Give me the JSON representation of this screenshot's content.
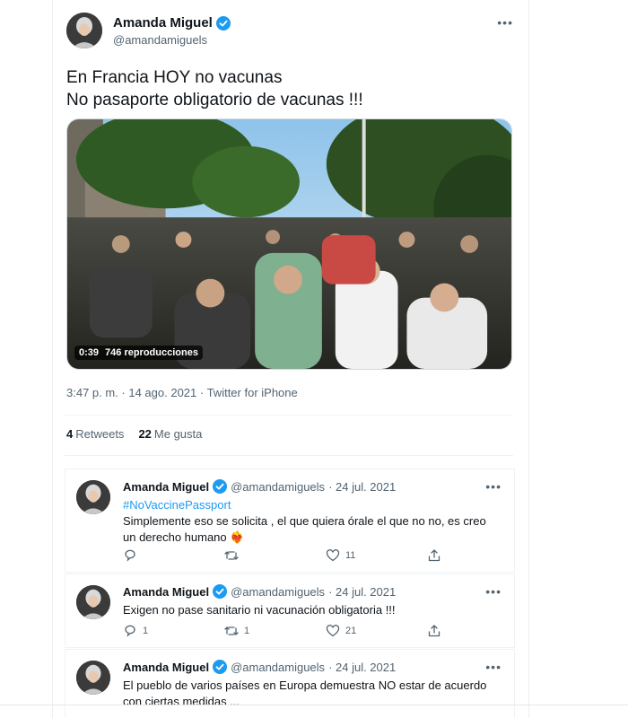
{
  "colors": {
    "accent": "#1d9bf0",
    "text": "#0f1419",
    "muted": "#536471",
    "border": "#eff3f4"
  },
  "main_tweet": {
    "author_name": "Amanda Miguel",
    "author_handle": "@amandamiguels",
    "text_lines": [
      "En Francia HOY no vacunas",
      "No pasaporte obligatorio de vacunas !!!"
    ],
    "media": {
      "duration": "0:39",
      "views": "746 reproducciones"
    },
    "meta": "3:47 p. m. · 14 ago. 2021 · Twitter for iPhone",
    "retweets": {
      "count": "4",
      "label": "Retweets"
    },
    "likes": {
      "count": "22",
      "label": "Me gusta"
    }
  },
  "replies": [
    {
      "name": "Amanda Miguel",
      "handle": "@amandamiguels",
      "date": "· 24 jul. 2021",
      "hashtag": "#NoVaccinePassport",
      "text": "Simplemente eso se solicita , el que quiera órale el que no no, es creo un derecho humano ❤️‍🔥",
      "counts": {
        "reply": "",
        "retweet": "",
        "like": "11"
      },
      "icons": [
        "reply-icon",
        "retweet-icon",
        "heart-icon",
        "share-icon"
      ]
    },
    {
      "name": "Amanda Miguel",
      "handle": "@amandamiguels",
      "date": "· 24 jul. 2021",
      "hashtag": "",
      "text": "Exigen no pase sanitario ni vacunación obligatoria !!!",
      "counts": {
        "reply": "1",
        "retweet": "1",
        "like": "21"
      },
      "icons": [
        "reply-icon",
        "retweet-icon",
        "heart-icon",
        "share-icon"
      ]
    },
    {
      "name": "Amanda Miguel",
      "handle": "@amandamiguels",
      "date": "· 24 jul. 2021",
      "hashtag": "",
      "text": "El pueblo de varios países en Europa demuestra NO estar de acuerdo con ciertas medidas ...",
      "counts": {
        "reply": "",
        "retweet": "",
        "like": ""
      },
      "icons": []
    }
  ]
}
